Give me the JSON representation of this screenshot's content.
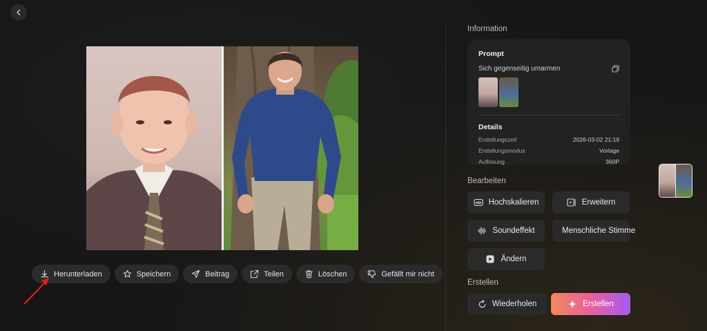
{
  "nav": {
    "back_icon": "chevron-left-icon"
  },
  "actions": [
    {
      "label": "Herunterladen",
      "icon": "download-icon"
    },
    {
      "label": "Speichern",
      "icon": "star-icon"
    },
    {
      "label": "Beitrag",
      "icon": "send-icon"
    },
    {
      "label": "Teilen",
      "icon": "share-icon"
    },
    {
      "label": "Löschen",
      "icon": "trash-icon"
    },
    {
      "label": "Gefällt mir nicht",
      "icon": "thumbs-down-icon"
    }
  ],
  "panel": {
    "information_title": "Information",
    "prompt": {
      "label": "Prompt",
      "text": "Sich gegenseitig umarmen",
      "copy_icon": "copy-icon"
    },
    "details": {
      "label": "Details",
      "rows": [
        {
          "key": "Erstellungszeit",
          "value": "2026-03-02 21:19"
        },
        {
          "key": "Erstellungsmodus",
          "value": "Vorlage"
        },
        {
          "key": "Auflösung",
          "value": "360P"
        }
      ]
    },
    "edit_title": "Bearbeiten",
    "edit_buttons": [
      {
        "label": "Hochskalieren",
        "icon": "hd-icon"
      },
      {
        "label": "Erweitern",
        "icon": "extend-video-icon"
      },
      {
        "label": "Soundeffekt",
        "icon": "waveform-icon"
      },
      {
        "label": "Menschliche Stimme",
        "icon": "lips-icon"
      },
      {
        "label": "Ändern",
        "icon": "edit-video-icon"
      }
    ],
    "create_title": "Erstellen",
    "repeat_label": "Wiederholen",
    "generate_label": "Erstellen"
  },
  "colors": {
    "background": "#161616",
    "button": "#2b2b2b",
    "accent_gradient_start": "#f08a5d",
    "accent_gradient_mid": "#ea5ea0",
    "accent_gradient_end": "#a35cf0",
    "annotation_arrow": "#e0201b"
  }
}
